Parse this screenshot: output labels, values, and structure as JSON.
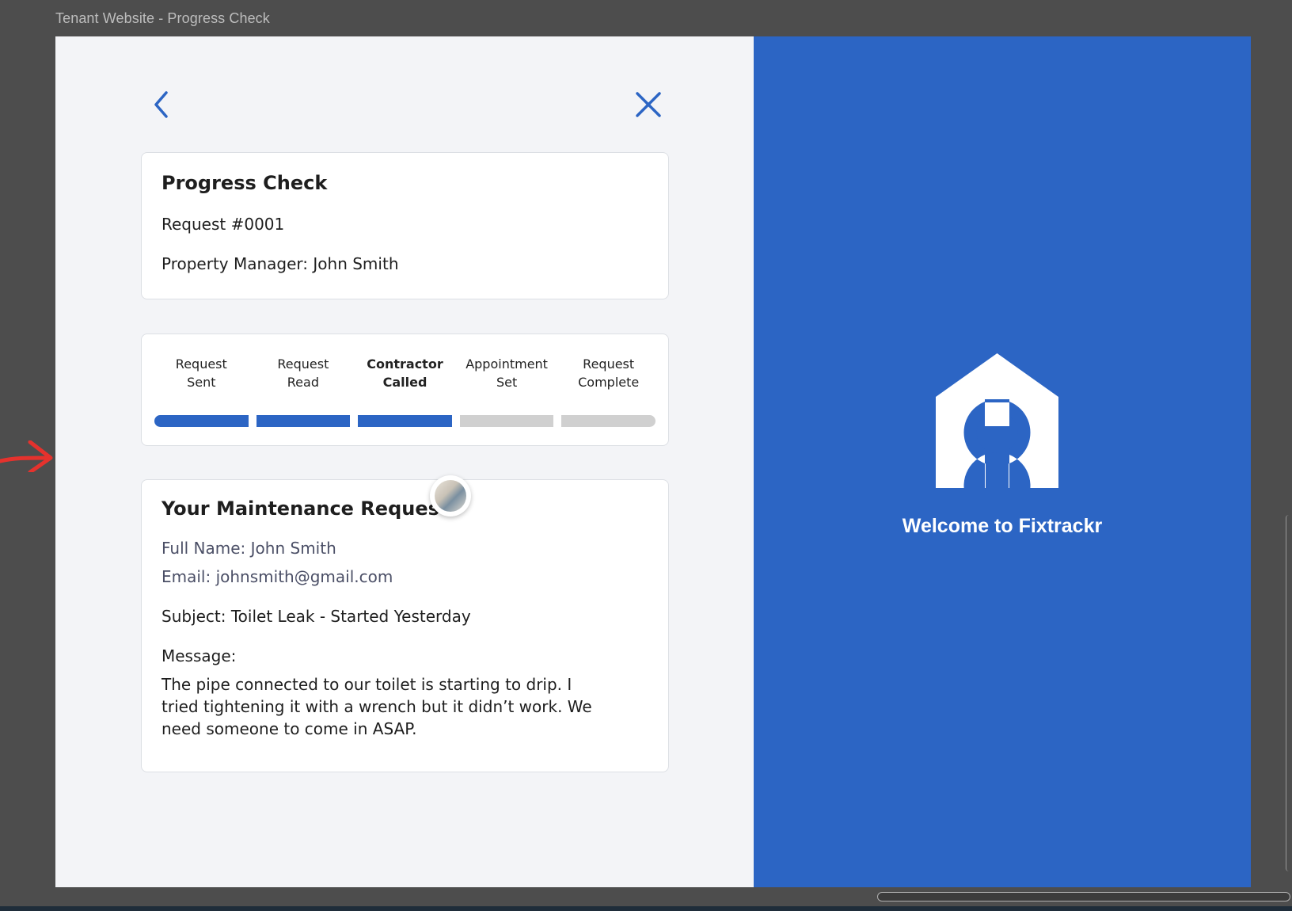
{
  "window": {
    "title": "Tenant Website - Progress Check"
  },
  "header_card": {
    "title": "Progress Check",
    "request_number": "Request #0001",
    "property_manager": "Property Manager: John Smith"
  },
  "progress": {
    "steps": [
      {
        "label": "Request\nSent",
        "done": true,
        "current": false
      },
      {
        "label": "Request\nRead",
        "done": true,
        "current": false
      },
      {
        "label": "Contractor\nCalled",
        "done": true,
        "current": true
      },
      {
        "label": "Appointment\nSet",
        "done": false,
        "current": false
      },
      {
        "label": "Request\nComplete",
        "done": false,
        "current": false
      }
    ],
    "completed_fraction": 0.6
  },
  "request_card": {
    "title": "Your Maintenance Request",
    "full_name": "Full Name: John Smith",
    "email": "Email: johnsmith@gmail.com",
    "subject": "Subject: Toilet Leak - Started Yesterday",
    "message_label": "Message:",
    "message": "The pipe connected to our toilet is starting to drip. I tried tightening it with a wrench but it didn’t work. We need someone to come in ASAP."
  },
  "brand": {
    "welcome": "Welcome to Fixtrackr",
    "logo_icon": "house-wrench-icon"
  },
  "icons": {
    "back": "chevron-left-icon",
    "close": "close-icon",
    "annotation": "red-arrow-icon"
  },
  "colors": {
    "accent": "#2c65c4",
    "inactive_bar": "#d0d0d0",
    "panel_bg": "#f3f4f7",
    "annotation_red": "#e5322d"
  }
}
